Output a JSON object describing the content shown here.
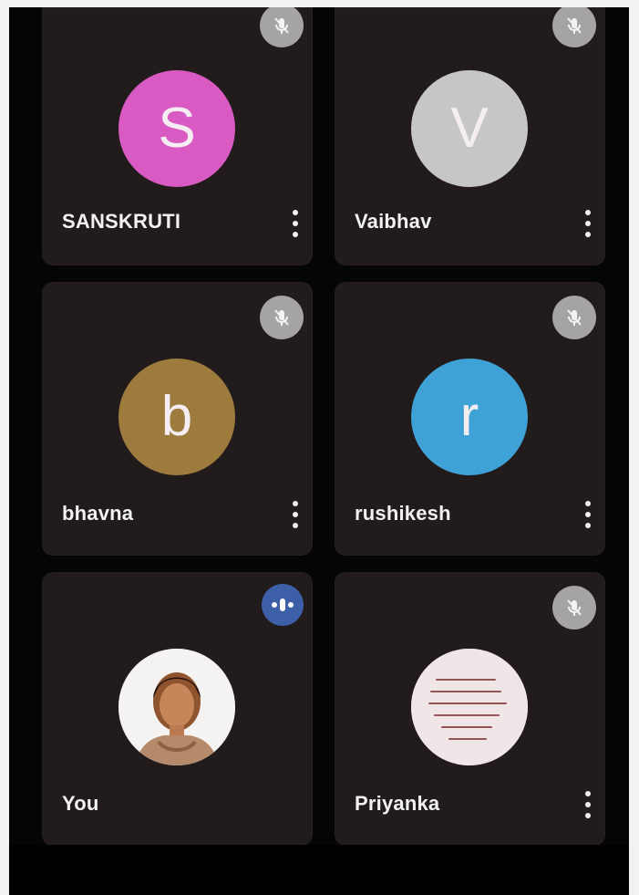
{
  "participants": [
    {
      "name": "SANSKRUTI",
      "initial": "S",
      "avatar_color": "#d95ac2",
      "status_icon": "mic-off-icon"
    },
    {
      "name": "Vaibhav",
      "initial": "V",
      "avatar_color": "#c7c6c6",
      "status_icon": "mic-off-icon"
    },
    {
      "name": "bhavna",
      "initial": "b",
      "avatar_color": "#9d7b3d",
      "status_icon": "mic-off-icon"
    },
    {
      "name": "rushikesh",
      "initial": "r",
      "avatar_color": "#3fa2d7",
      "status_icon": "mic-off-icon"
    },
    {
      "name": "You",
      "avatar_type": "photo",
      "status_icon": "speaking-icon"
    },
    {
      "name": "Priyanka",
      "avatar_type": "text-image",
      "status_icon": "mic-off-icon"
    }
  ],
  "colors": {
    "background": "#050505",
    "tile": "#221b1c",
    "mic_badge": "#a6a3a3",
    "speaking_badge": "#3d5fa8",
    "text": "#f1f1f1"
  }
}
